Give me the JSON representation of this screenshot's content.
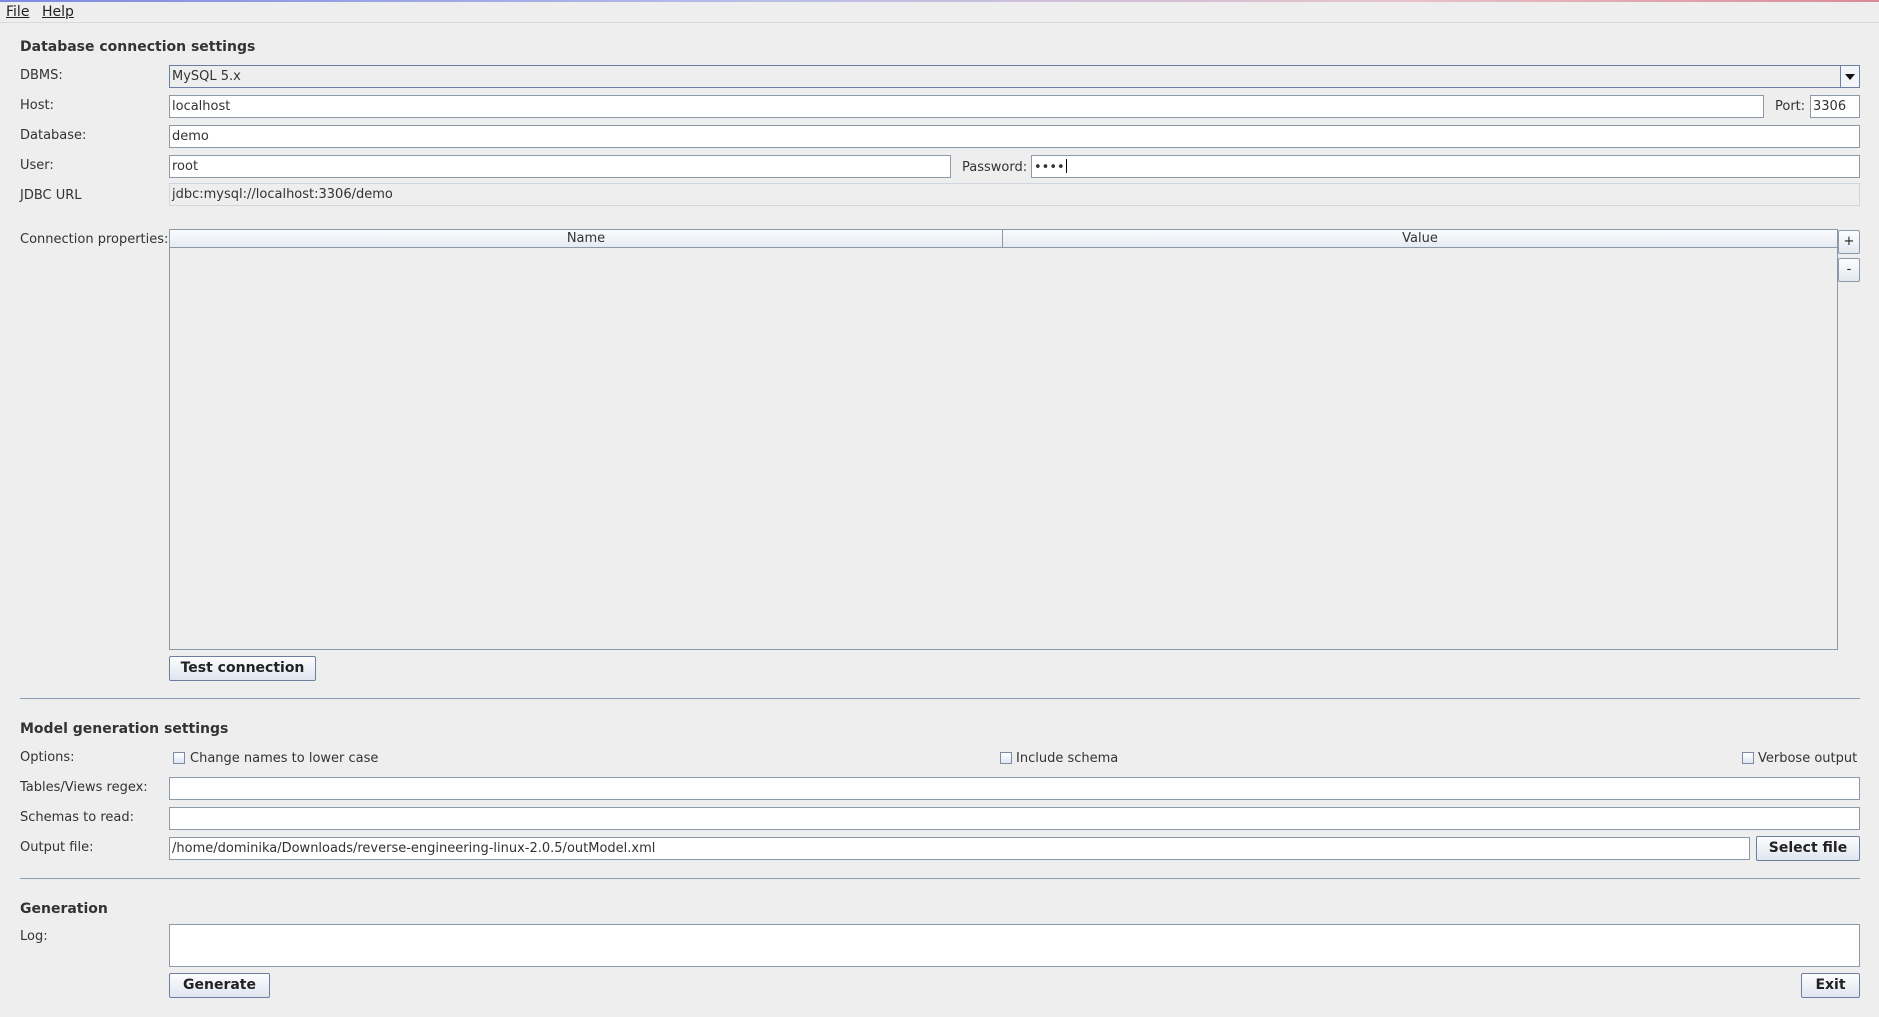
{
  "menu": {
    "file": "File",
    "help": "Help"
  },
  "db": {
    "section_title": "Database connection settings",
    "dbms_label": "DBMS:",
    "dbms_value": "MySQL 5.x",
    "host_label": "Host:",
    "host_value": "localhost",
    "port_label": "Port:",
    "port_value": "3306",
    "database_label": "Database:",
    "database_value": "demo",
    "user_label": "User:",
    "user_value": "root",
    "password_label": "Password:",
    "password_value": "••••",
    "jdbc_label": "JDBC URL",
    "jdbc_value": "jdbc:mysql://localhost:3306/demo",
    "props_label": "Connection properties:",
    "props_columns": [
      "Name",
      "Value"
    ],
    "add_label": "+",
    "remove_label": "-",
    "test_button": "Test connection"
  },
  "model": {
    "section_title": "Model generation settings",
    "options_label": "Options:",
    "opt_lowercase": "Change names to lower case",
    "opt_schema": "Include schema",
    "opt_verbose": "Verbose output",
    "regex_label": "Tables/Views regex:",
    "regex_value": "",
    "schemas_label": "Schemas to read:",
    "schemas_value": "",
    "output_label": "Output file:",
    "output_value": "/home/dominika/Downloads/reverse-engineering-linux-2.0.5/outModel.xml",
    "select_button": "Select file"
  },
  "gen": {
    "section_title": "Generation",
    "log_label": "Log:",
    "log_value": "",
    "generate_button": "Generate",
    "exit_button": "Exit"
  }
}
